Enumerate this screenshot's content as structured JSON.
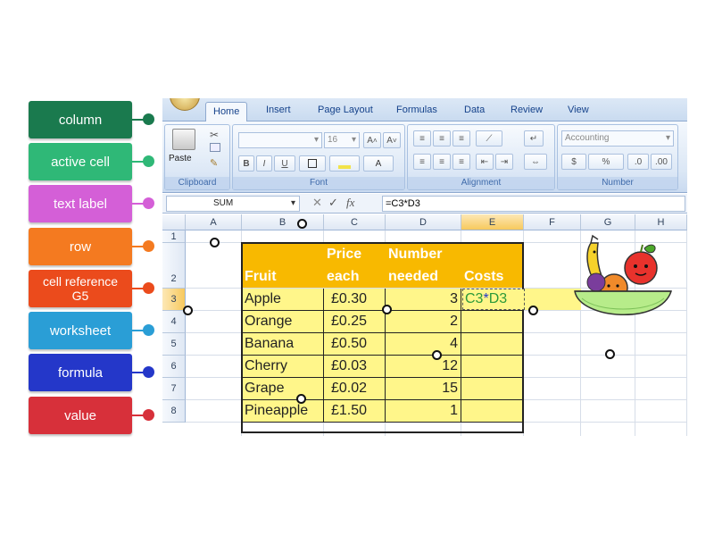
{
  "labels": [
    {
      "text": "column",
      "color": "#1a7a4e"
    },
    {
      "text": "active cell",
      "color": "#2fb877"
    },
    {
      "text": "text label",
      "color": "#d45fd7"
    },
    {
      "text": "row",
      "color": "#f47a20"
    },
    {
      "text": "cell reference G5",
      "color": "#eb4b1c"
    },
    {
      "text": "worksheet",
      "color": "#2a9ed6"
    },
    {
      "text": "formula",
      "color": "#2437c9"
    },
    {
      "text": "value",
      "color": "#d7303a"
    }
  ],
  "ribbon": {
    "tabs": [
      "Home",
      "Insert",
      "Page Layout",
      "Formulas",
      "Data",
      "Review",
      "View"
    ],
    "active_tab": "Home",
    "groups": {
      "clipboard": "Clipboard",
      "font": "Font",
      "alignment": "Alignment",
      "number": "Number"
    },
    "paste_label": "Paste",
    "font_size": "16",
    "number_format": "Accounting",
    "bold": "B",
    "italic": "I",
    "underline": "U"
  },
  "formula_bar": {
    "name_box": "SUM",
    "fx": "fx",
    "formula": "=C3*D3"
  },
  "sheet": {
    "columns": [
      "A",
      "B",
      "C",
      "D",
      "E",
      "F",
      "G",
      "H"
    ],
    "rows": [
      "1",
      "2",
      "3",
      "4",
      "5",
      "6",
      "7",
      "8"
    ],
    "header_fill": "#f8b900",
    "data_fill": "#fff68a",
    "headers": {
      "fruit": "Fruit",
      "price1": "Price",
      "price2": "each",
      "num1": "Number",
      "num2": "needed",
      "costs": "Costs"
    },
    "data": [
      {
        "fruit": "Apple",
        "price": "£0.30",
        "needed": "3"
      },
      {
        "fruit": "Orange",
        "price": "£0.25",
        "needed": "2"
      },
      {
        "fruit": "Banana",
        "price": "£0.50",
        "needed": "4"
      },
      {
        "fruit": "Cherry",
        "price": "£0.03",
        "needed": "12"
      },
      {
        "fruit": "Grape",
        "price": "£0.02",
        "needed": "15"
      },
      {
        "fruit": "Pineapple",
        "price": "£1.50",
        "needed": "1"
      }
    ],
    "editing_cell": "=C3*D3",
    "formula_color": "#2c9a3a",
    "formula_ref_c": "C3",
    "formula_ref_d": "D3",
    "formula_op": "*"
  }
}
